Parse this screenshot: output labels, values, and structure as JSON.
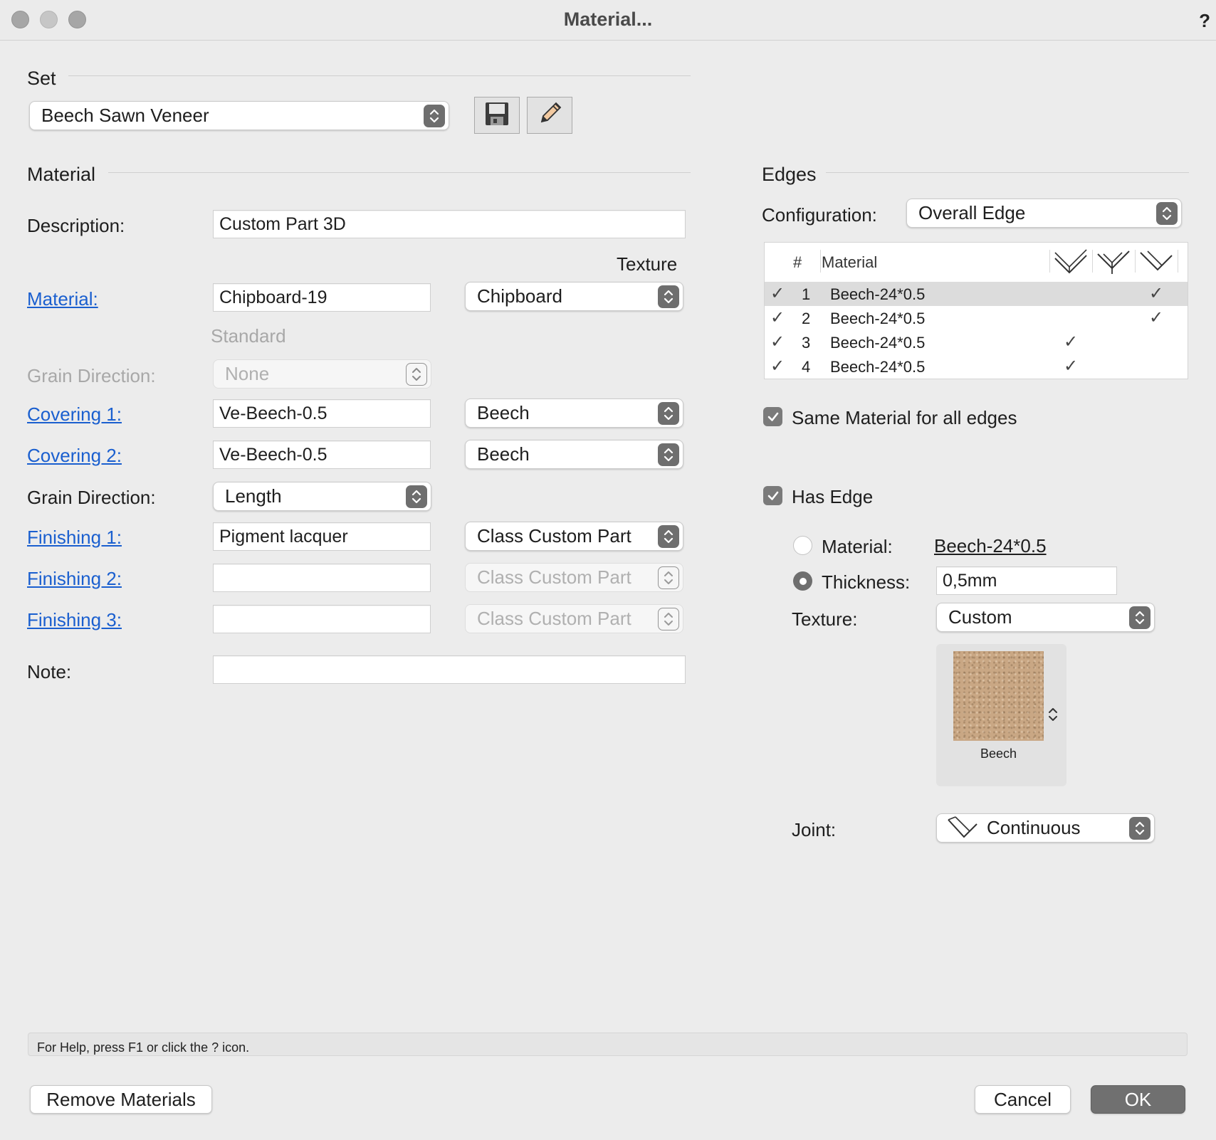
{
  "window": {
    "title": "Material...",
    "help_glyph": "?"
  },
  "set": {
    "section": "Set",
    "value": "Beech Sawn Veneer"
  },
  "material_section": {
    "section": "Material",
    "texture_header": "Texture",
    "description": {
      "label": "Description:",
      "value": "Custom Part 3D"
    },
    "material": {
      "label": "Material:",
      "value": "Chipboard-19",
      "texture": "Chipboard",
      "sub_label": "Standard"
    },
    "grain_direction_disabled": {
      "label": "Grain Direction:",
      "value": "None"
    },
    "covering1": {
      "label": "Covering 1:",
      "value": "Ve-Beech-0.5",
      "texture": "Beech"
    },
    "covering2": {
      "label": "Covering 2:",
      "value": "Ve-Beech-0.5",
      "texture": "Beech"
    },
    "grain_direction": {
      "label": "Grain Direction:",
      "value": "Length"
    },
    "finishing1": {
      "label": "Finishing 1:",
      "value": "Pigment lacquer",
      "class": "Class Custom Part"
    },
    "finishing2": {
      "label": "Finishing 2:",
      "value": "",
      "class": "Class Custom Part"
    },
    "finishing3": {
      "label": "Finishing 3:",
      "value": "",
      "class": "Class Custom Part"
    },
    "note": {
      "label": "Note:",
      "value": ""
    }
  },
  "edges": {
    "section": "Edges",
    "configuration": {
      "label": "Configuration:",
      "value": "Overall Edge"
    },
    "table": {
      "headers": {
        "num": "#",
        "material": "Material"
      },
      "rows": [
        {
          "num": "1",
          "material": "Beech-24*0.5",
          "check": "✓",
          "col": 3,
          "selected": true
        },
        {
          "num": "2",
          "material": "Beech-24*0.5",
          "check": "✓",
          "col": 3,
          "selected": false
        },
        {
          "num": "3",
          "material": "Beech-24*0.5",
          "check": "✓",
          "col": 1,
          "selected": false
        },
        {
          "num": "4",
          "material": "Beech-24*0.5",
          "check": "✓",
          "col": 1,
          "selected": false
        }
      ]
    },
    "same_material": {
      "label": "Same Material for all edges",
      "checked": true
    },
    "has_edge": {
      "label": "Has Edge",
      "checked": true
    },
    "material_radio": {
      "label": "Material:",
      "value": "Beech-24*0.5",
      "selected": false
    },
    "thickness_radio": {
      "label": "Thickness:",
      "value": "0,5mm",
      "selected": true
    },
    "texture": {
      "label": "Texture:",
      "value": "Custom",
      "swatch_name": "Beech",
      "swatch_color": "#c9a784"
    },
    "joint": {
      "label": "Joint:",
      "value": "Continuous"
    }
  },
  "status": {
    "text": "For Help, press F1 or click the ? icon."
  },
  "buttons": {
    "remove": "Remove Materials",
    "cancel": "Cancel",
    "ok": "OK"
  }
}
